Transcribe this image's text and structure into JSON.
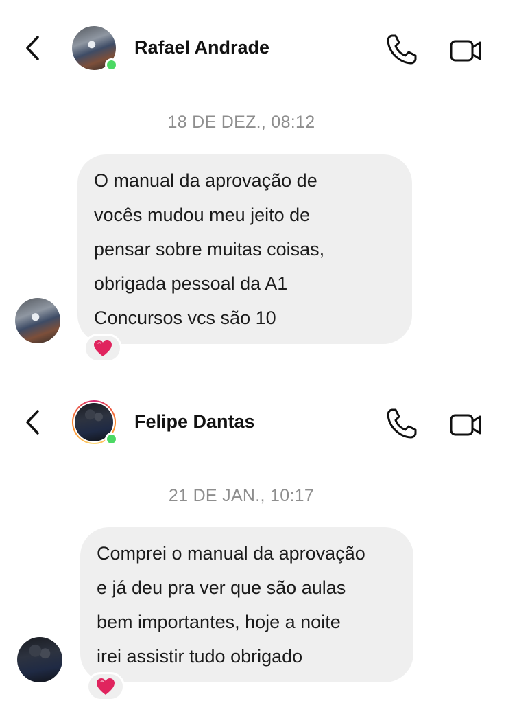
{
  "conversations": [
    {
      "contact_name": "Rafael Andrade",
      "online": true,
      "timestamp": "18 DE DEZ., 08:12",
      "message_lines": [
        "O manual da aprovação de",
        "vocês mudou meu jeito de",
        "pensar sobre muitas coisas,",
        "obrigada pessoal da A1",
        "Concursos vcs são 10"
      ],
      "reaction": "❤️"
    },
    {
      "contact_name": "Felipe Dantas",
      "online": true,
      "has_story_ring": true,
      "timestamp": "21 DE JAN., 10:17",
      "message_lines": [
        "Comprei o manual da aprovação",
        "e já deu pra ver que são aulas",
        "bem importantes, hoje a noite",
        "irei assistir tudo obrigado"
      ],
      "reaction": "❤️"
    }
  ],
  "icons": {
    "back": "chevron-left-icon",
    "call": "phone-icon",
    "video": "video-camera-icon",
    "reaction": "heart-icon"
  },
  "colors": {
    "online": "#4cd964",
    "bubble": "#efefef",
    "timestamp": "#8e8e8e",
    "heart": "#e0245e"
  }
}
